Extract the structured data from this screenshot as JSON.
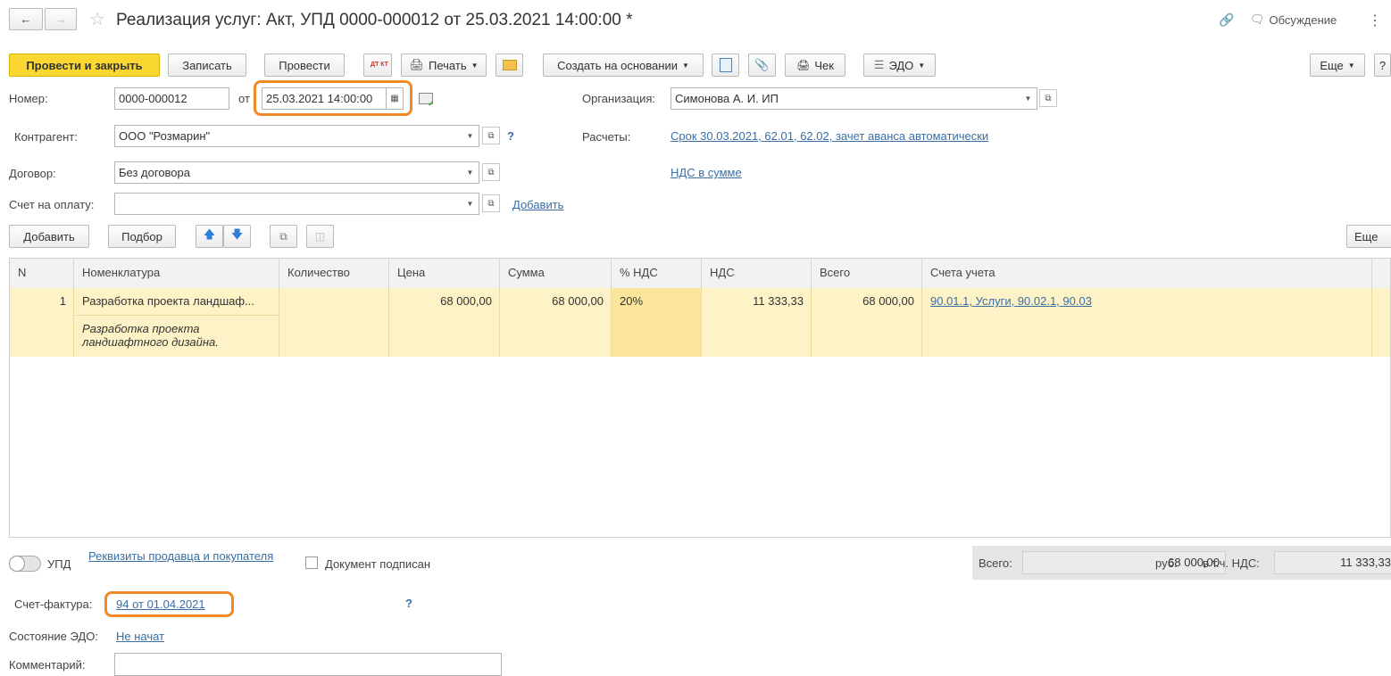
{
  "window": {
    "title": "Реализация услуг: Акт, УПД 0000-000012 от 25.03.2021 14:00:00 *",
    "discussion": "Обсуждение",
    "nav_back": "←",
    "nav_forward": "→",
    "star": "☆",
    "more_dots": "⋮"
  },
  "toolbar": {
    "post_close": "Провести и закрыть",
    "save": "Записать",
    "post": "Провести",
    "dt_kt": "ДТ КТ",
    "print": "Печать",
    "create_based": "Создать на основании",
    "check": "Чек",
    "edo": "ЭДО",
    "more": "Еще",
    "help": "?"
  },
  "form": {
    "number_label": "Номер:",
    "number_value": "0000-000012",
    "from_label": "от",
    "date_value": "25.03.2021 14:00:00",
    "org_label": "Организация:",
    "org_value": "Симонова А. И. ИП",
    "counterparty_label": "Контрагент:",
    "counterparty_value": "ООО \"Розмарин\"",
    "help_q": "?",
    "settlements_label": "Расчеты:",
    "settlements_link": "Срок 30.03.2021, 62.01, 62.02, зачет аванса автоматически",
    "contract_label": "Договор:",
    "contract_value": "Без договора",
    "vat_link": "НДС в сумме",
    "invoice_pay_label": "Счет на оплату:",
    "invoice_pay_value": "",
    "add_link": "Добавить"
  },
  "table_toolbar": {
    "add": "Добавить",
    "select": "Подбор",
    "more": "Еще"
  },
  "table": {
    "columns": [
      "N",
      "Номенклатура",
      "Количество",
      "Цена",
      "Сумма",
      "% НДС",
      "НДС",
      "Всего",
      "Счета учета"
    ],
    "rows": [
      {
        "n": "1",
        "item": "Разработка проекта ландшаф...",
        "item_desc": "Разработка проекта ландшафтного дизайна.",
        "qty": "",
        "price": "68 000,00",
        "sum": "68 000,00",
        "vat_rate": "20%",
        "vat": "11 333,33",
        "total": "68 000,00",
        "accounts": "90.01.1, Услуги, 90.02.1, 90.03"
      }
    ]
  },
  "footer": {
    "upd_label": "УПД",
    "requisites_link": "Реквизиты продавца и покупателя",
    "signed_label": "Документ подписан",
    "total_label": "Всего:",
    "total_value": "68 000,00",
    "currency": "руб.",
    "vat_incl_label": "в т.ч. НДС:",
    "vat_incl_value": "11 333,33",
    "invoice_label": "Счет-фактура:",
    "invoice_link": "94 от 01.04.2021",
    "help_q": "?",
    "edo_state_label": "Состояние ЭДО:",
    "edo_state_link": "Не начат",
    "comment_label": "Комментарий:",
    "comment_value": ""
  },
  "colors": {
    "primary_button": "#fbd732",
    "highlight": "#f08a24",
    "row_selected": "#fdf3c7",
    "vat_cell": "#fbe59a",
    "link": "#3a6ea5"
  }
}
